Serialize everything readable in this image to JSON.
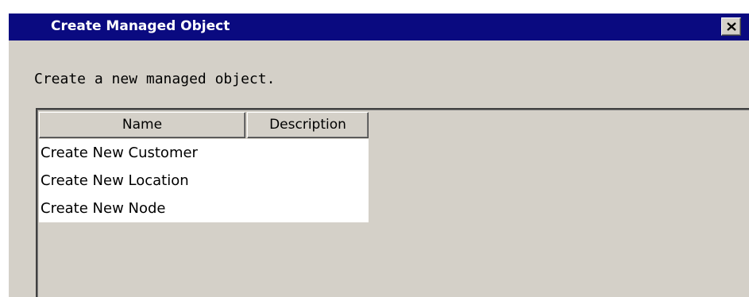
{
  "window": {
    "title": "Create Managed Object",
    "close_icon": "close-icon"
  },
  "main": {
    "description": "Create a new managed object."
  },
  "table": {
    "columns": [
      {
        "label": "Name"
      },
      {
        "label": "Description"
      }
    ],
    "rows": [
      {
        "name": "Create New Customer",
        "description": ""
      },
      {
        "name": "Create New Location",
        "description": ""
      },
      {
        "name": "Create New Node",
        "description": ""
      }
    ]
  },
  "colors": {
    "titlebar": "#0a0a80",
    "window_background": "#d4d0c8",
    "list_background": "#ffffff"
  }
}
